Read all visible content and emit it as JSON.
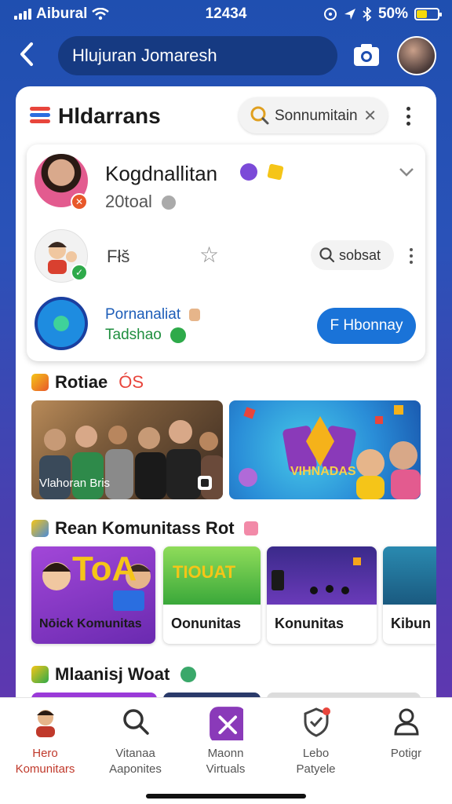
{
  "status": {
    "carrier": "Aibural",
    "time": "12434",
    "battery_pct": "50%"
  },
  "header": {
    "title": "Hlujuran Jomaresh"
  },
  "card": {
    "title": "Hldarrans",
    "search_text": "Sonnumitain",
    "feed": {
      "user1": {
        "name": "Kogdnallitan",
        "subtitle": "20toal"
      },
      "row2_label": "Fłš",
      "row2_search": "sobsat",
      "row3": {
        "line1": "Pornanaliat",
        "line2": "Tadshao",
        "join_label": "F Hbonnay"
      }
    },
    "section1": {
      "title": "Rotiae",
      "suffix": "ÓS"
    },
    "tiles_large": [
      {
        "caption": "Vlahoran Bris"
      },
      {
        "caption": "VIHNADAS"
      }
    ],
    "section2": {
      "title": "Rean Komunitass Rot"
    },
    "tiles_small": [
      {
        "label": "Nōick Komunitas",
        "art_text": "ToA"
      },
      {
        "label": "Oonunitas",
        "art_text": "TIOUAT"
      },
      {
        "label": "Konunitas"
      },
      {
        "label": "Kibun"
      }
    ],
    "section3": {
      "title": "Mlaanisj Woat"
    }
  },
  "bottom_nav": [
    {
      "line1": "Hero",
      "line2": "Komunitars"
    },
    {
      "line1": "Vitanaa",
      "line2": "Aaponites"
    },
    {
      "line1": "Maonn",
      "line2": "Virtuals"
    },
    {
      "line1": "Lebo",
      "line2": "Patyele"
    },
    {
      "line1": "Potigr",
      "line2": ""
    }
  ],
  "colors": {
    "accent_blue": "#1a73d8",
    "purple": "#8a3ab9",
    "header_bg": "#1f4fb0"
  },
  "icons": [
    "back-arrow-icon",
    "camera-icon",
    "menu-icon",
    "search-icon",
    "close-icon",
    "kebab-icon",
    "chevron-down-icon",
    "star-icon",
    "profile-icon",
    "close-x-icon",
    "shield-icon",
    "person-icon"
  ]
}
